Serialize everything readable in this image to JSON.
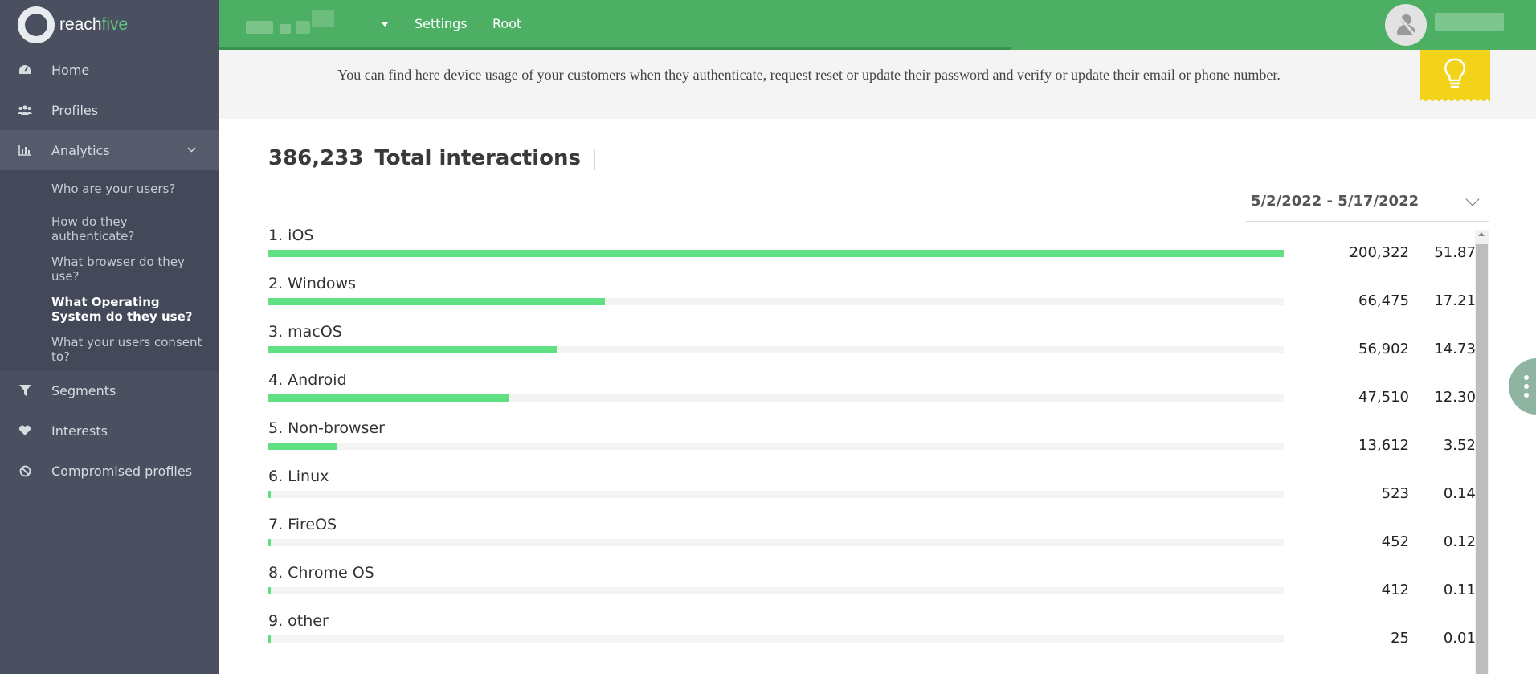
{
  "brand": {
    "part1": "reach",
    "part2": "five"
  },
  "topbar": {
    "links": [
      "Settings",
      "Root"
    ]
  },
  "sidebar": {
    "items": [
      {
        "label": "Home",
        "icon": "gauge-icon"
      },
      {
        "label": "Profiles",
        "icon": "users-icon"
      },
      {
        "label": "Analytics",
        "icon": "bar-chart-icon"
      },
      {
        "label": "Segments",
        "icon": "filter-icon"
      },
      {
        "label": "Interests",
        "icon": "heart-icon"
      },
      {
        "label": "Compromised profiles",
        "icon": "ban-icon"
      }
    ],
    "analytics_sub": [
      "Who are your users?",
      "How do they authenticate?",
      "What browser do they use?",
      "What Operating System do they use?",
      "What your users consent to?"
    ]
  },
  "banner": {
    "text": "You can find here device usage of your customers when they authenticate, request reset or update their password and verify or update their email or phone number."
  },
  "summary": {
    "total": "386,233",
    "label": "Total interactions"
  },
  "filter": {
    "date_range": "5/2/2022 - 5/17/2022"
  },
  "rows": [
    {
      "label": "1. iOS",
      "count": "200,322",
      "percent": "51.87%",
      "value": 200322
    },
    {
      "label": "2. Windows",
      "count": "66,475",
      "percent": "17.21%",
      "value": 66475
    },
    {
      "label": "3. macOS",
      "count": "56,902",
      "percent": "14.73%",
      "value": 56902
    },
    {
      "label": "4. Android",
      "count": "47,510",
      "percent": "12.30%",
      "value": 47510
    },
    {
      "label": "5. Non-browser",
      "count": "13,612",
      "percent": "3.52%",
      "value": 13612
    },
    {
      "label": "6. Linux",
      "count": "523",
      "percent": "0.14%",
      "value": 523
    },
    {
      "label": "7. FireOS",
      "count": "452",
      "percent": "0.12%",
      "value": 452
    },
    {
      "label": "8. Chrome OS",
      "count": "412",
      "percent": "0.11%",
      "value": 412
    },
    {
      "label": "9. other",
      "count": "25",
      "percent": "0.01%",
      "value": 25
    }
  ],
  "colors": {
    "topbar": "#4caf63",
    "sidebar": "#4a5060",
    "bar": "#5ee083",
    "tip": "#f2d31a"
  }
}
